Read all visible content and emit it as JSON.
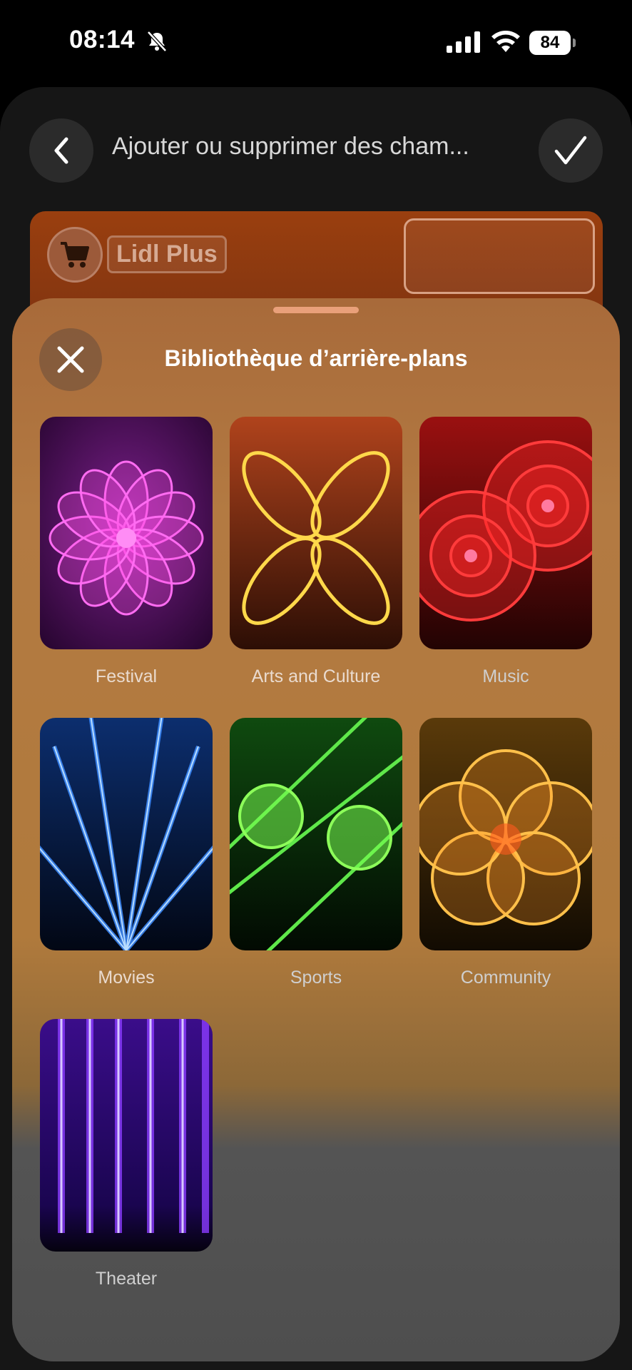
{
  "status_bar": {
    "time": "08:14",
    "battery": "84"
  },
  "nav": {
    "title": "Ajouter ou supprimer des cham..."
  },
  "pass": {
    "name": "Lidl Plus"
  },
  "sheet": {
    "title": "Bibliothèque d’arrière-plans",
    "backgrounds": [
      {
        "label": "Festival"
      },
      {
        "label": "Arts and Culture"
      },
      {
        "label": "Music"
      },
      {
        "label": "Movies"
      },
      {
        "label": "Sports"
      },
      {
        "label": "Community"
      },
      {
        "label": "Theater"
      }
    ]
  },
  "icons": {
    "silent": "bell-slash-icon",
    "signal": "cellular-signal-icon",
    "wifi": "wifi-icon",
    "back": "chevron-left-icon",
    "confirm": "checkmark-icon",
    "cart": "shopping-cart-icon",
    "close": "close-icon"
  },
  "colors": {
    "pass_card": "#8a3a12",
    "sheet_tint": "#b07a3c",
    "background": "#000000"
  }
}
